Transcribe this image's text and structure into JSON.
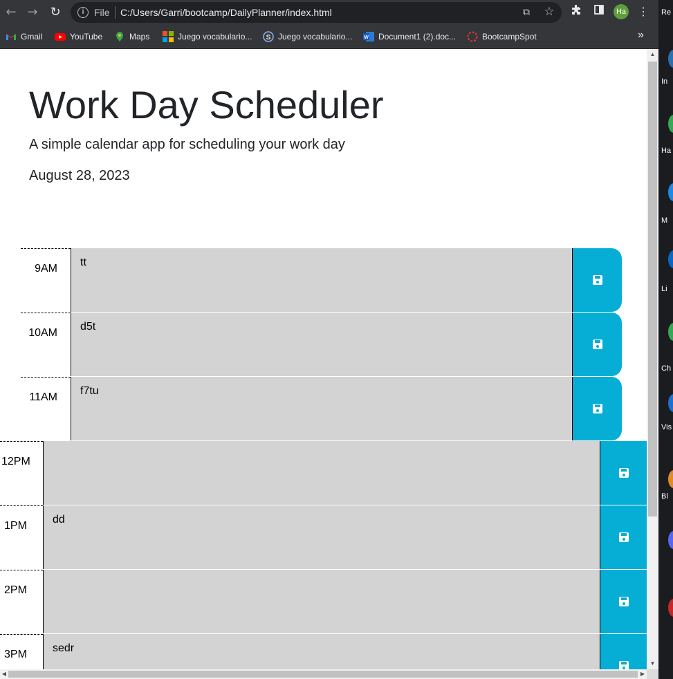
{
  "browser": {
    "scheme": "File",
    "url": "C:/Users/Garri/bootcamp/DailyPlanner/index.html",
    "profile_initials": "Ha",
    "bookmarks": [
      {
        "label": "Gmail",
        "icon": "gmail-icon"
      },
      {
        "label": "YouTube",
        "icon": "youtube-icon"
      },
      {
        "label": "Maps",
        "icon": "maps-icon"
      },
      {
        "label": "Juego vocabulario...",
        "icon": "microsoft-icon"
      },
      {
        "label": "Juego vocabulario...",
        "icon": "s-icon"
      },
      {
        "label": "Document1 (2).doc...",
        "icon": "word-icon"
      },
      {
        "label": "BootcampSpot",
        "icon": "bootcampspot-icon"
      }
    ],
    "more_bookmarks": "»"
  },
  "page": {
    "title": "Work Day Scheduler",
    "lead": "A simple calendar app for scheduling your work day",
    "current_day": "August 28, 2023",
    "rows": [
      {
        "hour": "9AM",
        "text": "tt"
      },
      {
        "hour": "10AM",
        "text": "d5t"
      },
      {
        "hour": "11AM",
        "text": "f7tu"
      },
      {
        "hour": "12PM",
        "text": ""
      },
      {
        "hour": "1PM",
        "text": "dd"
      },
      {
        "hour": "2PM",
        "text": ""
      },
      {
        "hour": "3PM",
        "text": "sedr"
      }
    ]
  },
  "desktop": {
    "labels": [
      "Re",
      "In",
      "Ha",
      "M",
      "Li",
      "Ch",
      "Vis",
      "Bl"
    ]
  },
  "colors": {
    "save_button": "#06aed5",
    "time_block": "#d3d3d3"
  }
}
